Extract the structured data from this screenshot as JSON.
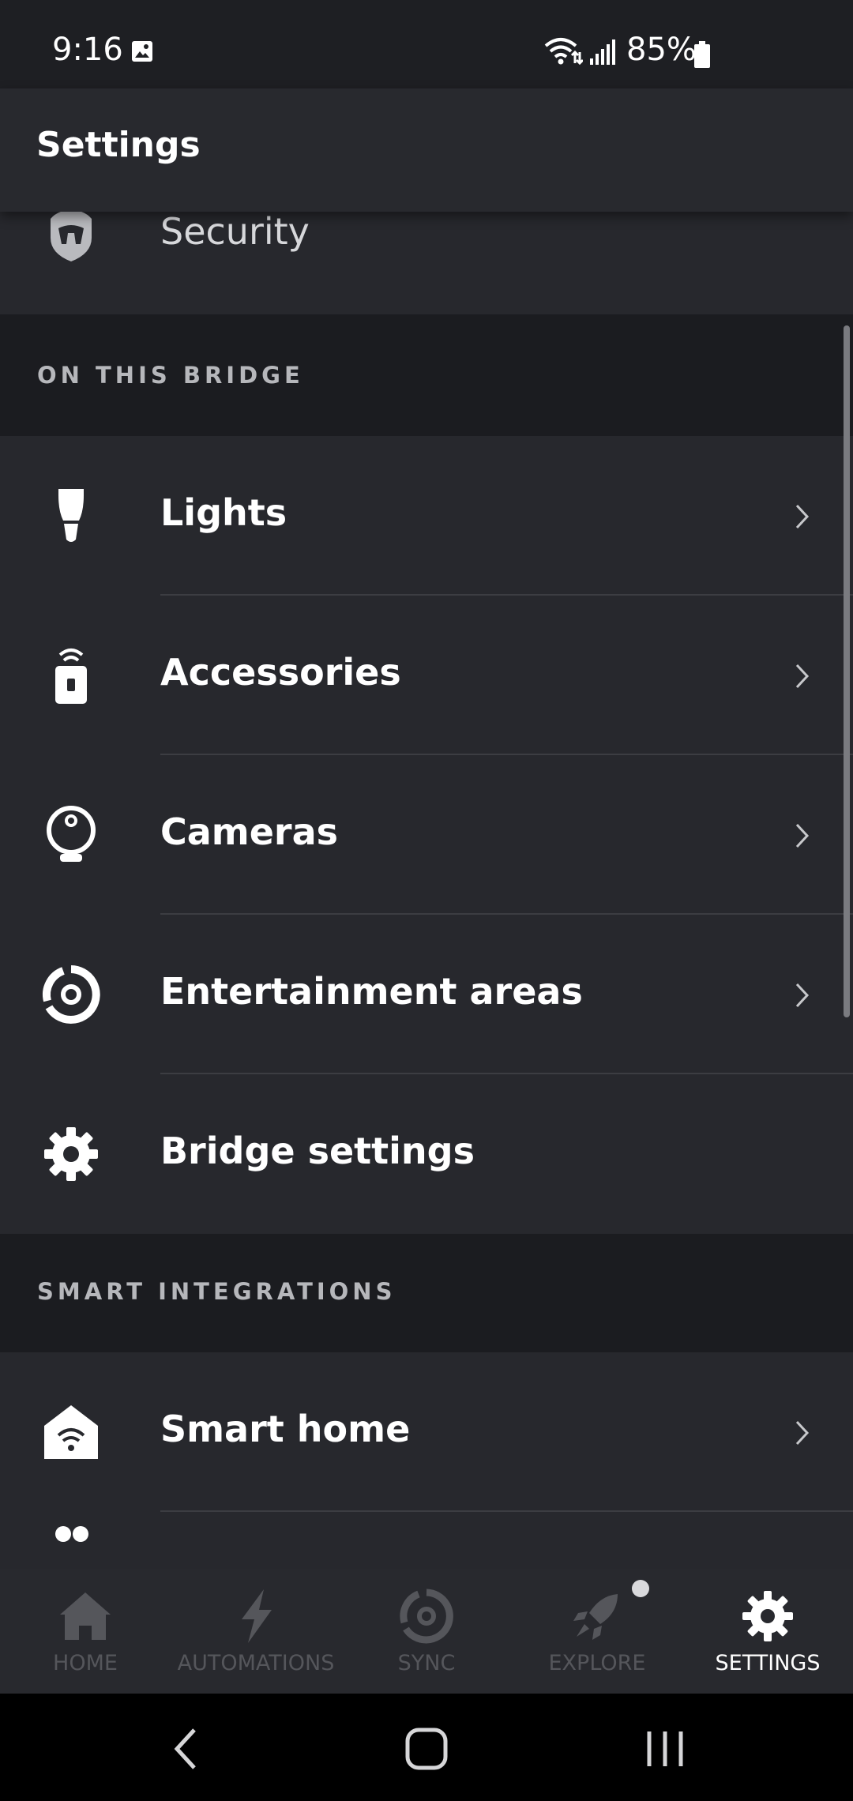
{
  "status_bar": {
    "time": "9:16",
    "battery": "85%"
  },
  "header": {
    "title": "Settings"
  },
  "rows": {
    "security": {
      "label": "Security",
      "icon": "security-shield-icon"
    },
    "lights": {
      "label": "Lights",
      "icon": "bulb-icon"
    },
    "accessories": {
      "label": "Accessories",
      "icon": "remote-icon"
    },
    "cameras": {
      "label": "Cameras",
      "icon": "camera-icon"
    },
    "entertainment": {
      "label": "Entertainment areas",
      "icon": "entertainment-icon"
    },
    "bridge_settings": {
      "label": "Bridge settings",
      "icon": "gear-icon"
    },
    "smart_home": {
      "label": "Smart home",
      "icon": "smart-home-icon"
    }
  },
  "sections": {
    "on_this_bridge": "ON THIS BRIDGE",
    "smart_integrations": "SMART INTEGRATIONS"
  },
  "bottom_nav": {
    "home": "HOME",
    "automations": "AUTOMATIONS",
    "sync": "SYNC",
    "explore": "EXPLORE",
    "settings": "SETTINGS",
    "active": "settings"
  },
  "colors": {
    "background": "#1b1c20",
    "row": "#27282d",
    "inactive_nav": "#55565b"
  }
}
